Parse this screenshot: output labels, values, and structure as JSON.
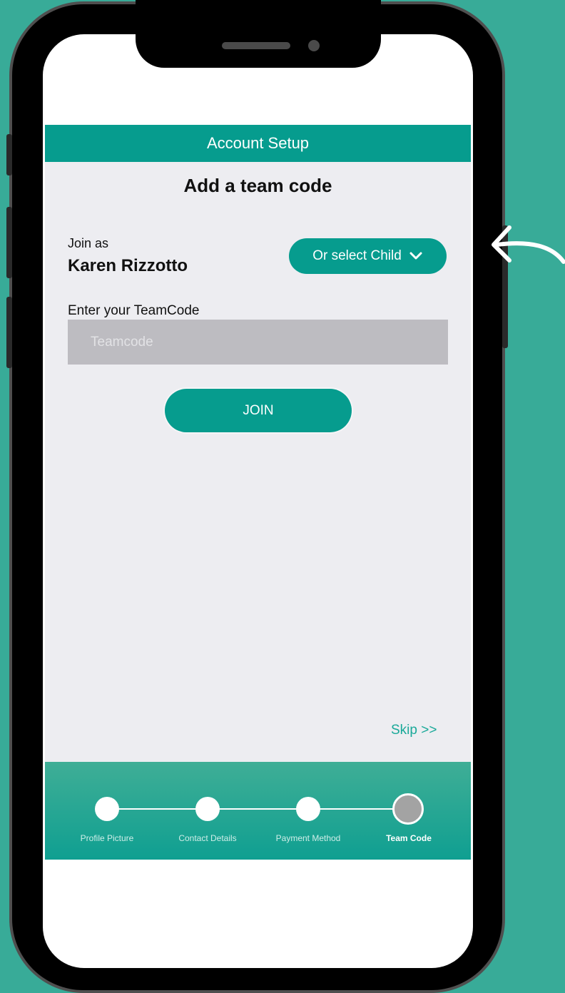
{
  "app": {
    "header_title": "Account Setup",
    "page_heading": "Add a team code",
    "join_as_label": "Join as",
    "user_name": "Karen Rizzotto",
    "select_child_label": "Or select Child",
    "teamcode_label": "Enter your TeamCode",
    "teamcode_placeholder": "Teamcode",
    "teamcode_value": "",
    "join_button": "JOIN",
    "skip_link": "Skip >>"
  },
  "steps": [
    {
      "label": "Profile Picture",
      "state": "done"
    },
    {
      "label": "Contact Details",
      "state": "done"
    },
    {
      "label": "Payment Method",
      "state": "done"
    },
    {
      "label": "Team Code",
      "state": "current"
    }
  ],
  "colors": {
    "background": "#38ab98",
    "brand": "#069c8e",
    "app_bg": "#ededf1",
    "input_bg": "#bdbcc1"
  },
  "icons": {
    "dropdown": "chevron-down-icon",
    "annotation": "curved-arrow-icon"
  }
}
